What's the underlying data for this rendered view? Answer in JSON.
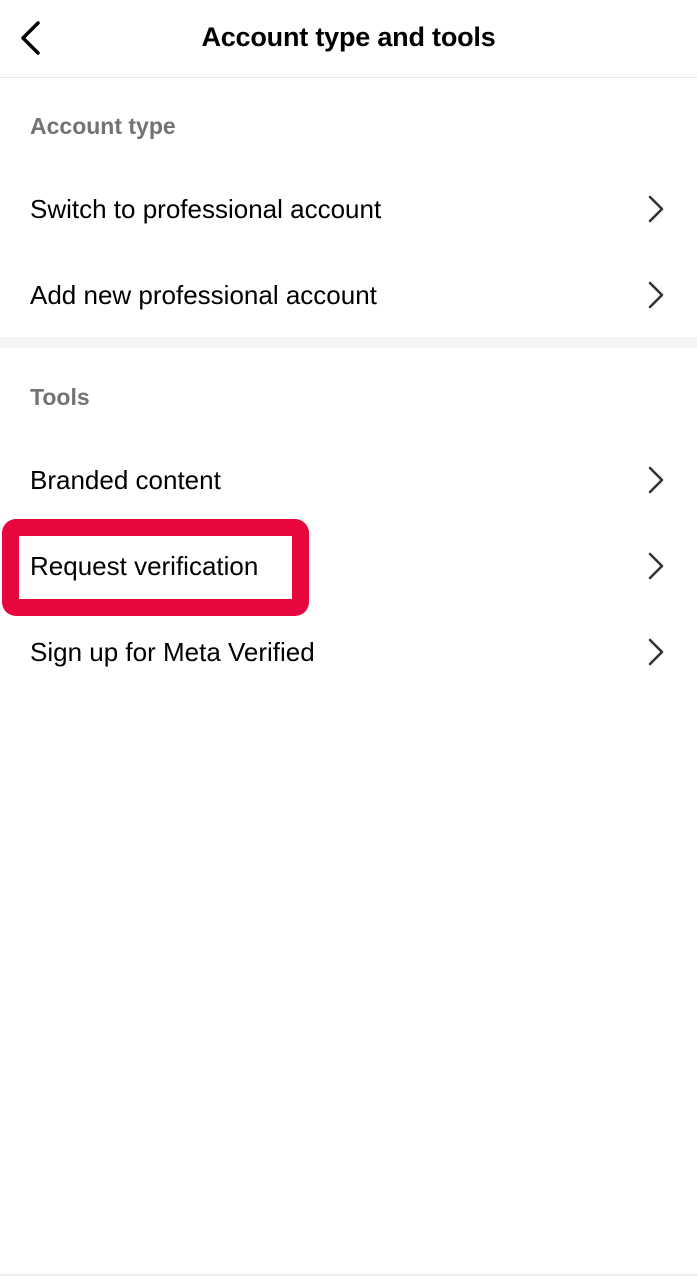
{
  "header": {
    "title": "Account type and tools",
    "back_icon": "chevron-left-icon"
  },
  "sections": [
    {
      "label": "Account type",
      "items": [
        {
          "label": "Switch to professional account",
          "icon": "chevron-right-icon"
        },
        {
          "label": "Add new professional account",
          "icon": "chevron-right-icon"
        }
      ]
    },
    {
      "label": "Tools",
      "items": [
        {
          "label": "Branded content",
          "icon": "chevron-right-icon"
        },
        {
          "label": "Request verification",
          "icon": "chevron-right-icon",
          "highlighted": true
        },
        {
          "label": "Sign up for Meta Verified",
          "icon": "chevron-right-icon"
        }
      ]
    }
  ],
  "colors": {
    "highlight": "#e8063f",
    "section_label": "#737373",
    "divider": "#f4f4f4"
  }
}
